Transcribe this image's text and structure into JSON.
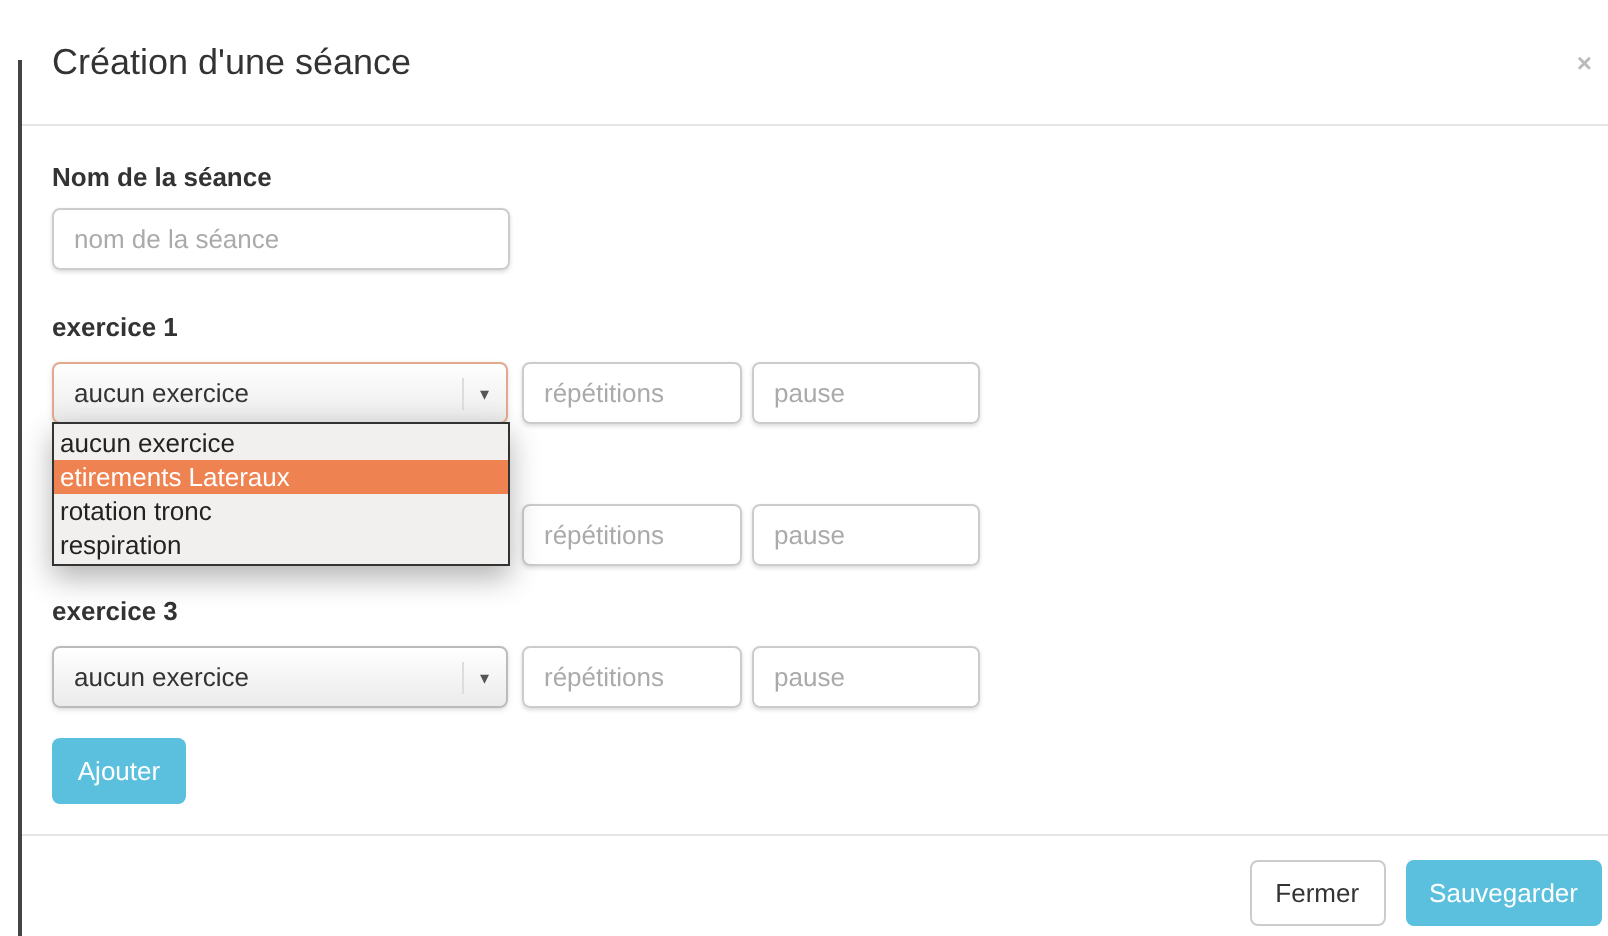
{
  "dialog": {
    "title": "Création d'une séance",
    "close": "×"
  },
  "name_field": {
    "label": "Nom de la séance",
    "placeholder": "nom de la séance"
  },
  "exercises": [
    {
      "label": "exercice 1",
      "value": "aucun exercice",
      "caret": "▾",
      "reps_placeholder": "répétitions",
      "pause_placeholder": "pause",
      "open": true,
      "options": [
        {
          "text": "aucun exercice",
          "highlighted": false
        },
        {
          "text": "etirements Lateraux",
          "highlighted": true
        },
        {
          "text": "rotation tronc",
          "highlighted": false
        },
        {
          "text": "respiration",
          "highlighted": false
        }
      ]
    },
    {
      "reps_placeholder": "répétitions",
      "pause_placeholder": "pause",
      "open": false
    },
    {
      "label": "exercice 3",
      "value": "aucun exercice",
      "caret": "▾",
      "reps_placeholder": "répétitions",
      "pause_placeholder": "pause",
      "open": false
    }
  ],
  "add_button": "Ajouter",
  "footer_buttons": [
    {
      "label": "Fermer",
      "kind": "default"
    },
    {
      "label": "Sauvegarder",
      "kind": "primary"
    }
  ]
}
